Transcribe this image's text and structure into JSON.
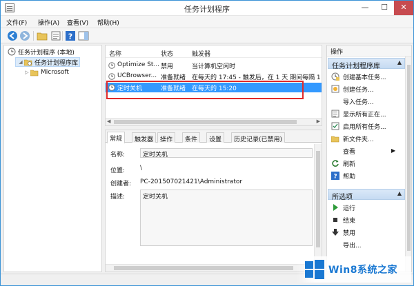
{
  "window": {
    "title": "任务计划程序",
    "controls": {
      "minimize": "—",
      "maximize": "☐",
      "close": "✕"
    }
  },
  "menu": [
    "文件(F)",
    "操作(A)",
    "查看(V)",
    "帮助(H)"
  ],
  "tree": {
    "root": "任务计划程序 (本地)",
    "library": "任务计划程序库",
    "child": "Microsoft"
  },
  "task_list": {
    "columns": [
      "名称",
      "状态",
      "触发器"
    ],
    "rows": [
      {
        "name": "Optimize St...",
        "status": "禁用",
        "trigger": "当计算机空闲时"
      },
      {
        "name": "UCBrowser...",
        "status": "准备就绪",
        "trigger": "在每天的 17:45 - 触发后，在 1 天 期间每隔 1"
      },
      {
        "name": "定时关机",
        "status": "准备就绪",
        "trigger": "在每天的 15:20"
      }
    ]
  },
  "detail": {
    "tabs": [
      "常规",
      "触发器",
      "操作",
      "条件",
      "设置",
      "历史记录(已禁用)"
    ],
    "name_label": "名称:",
    "name_value": "定时关机",
    "location_label": "位置:",
    "location_value": "\\",
    "author_label": "创建者:",
    "author_value": "PC-201507021421\\Administrator",
    "desc_label": "描述:",
    "desc_value": "定时关机"
  },
  "actions": {
    "header": "操作",
    "section1": "任务计划程序库",
    "section1_items": [
      "创建基本任务...",
      "创建任务...",
      "导入任务...",
      "显示所有正在...",
      "启用所有任务...",
      "新文件夹...",
      "查看",
      "刷新",
      "帮助"
    ],
    "section2": "所选项",
    "section2_items": [
      "运行",
      "结束",
      "禁用",
      "导出..."
    ]
  },
  "watermark": {
    "text": "Win8系统之家"
  },
  "colors": {
    "selection": "#3399ff",
    "highlight_box": "#e02a2a",
    "brand": "#1a78d2"
  }
}
